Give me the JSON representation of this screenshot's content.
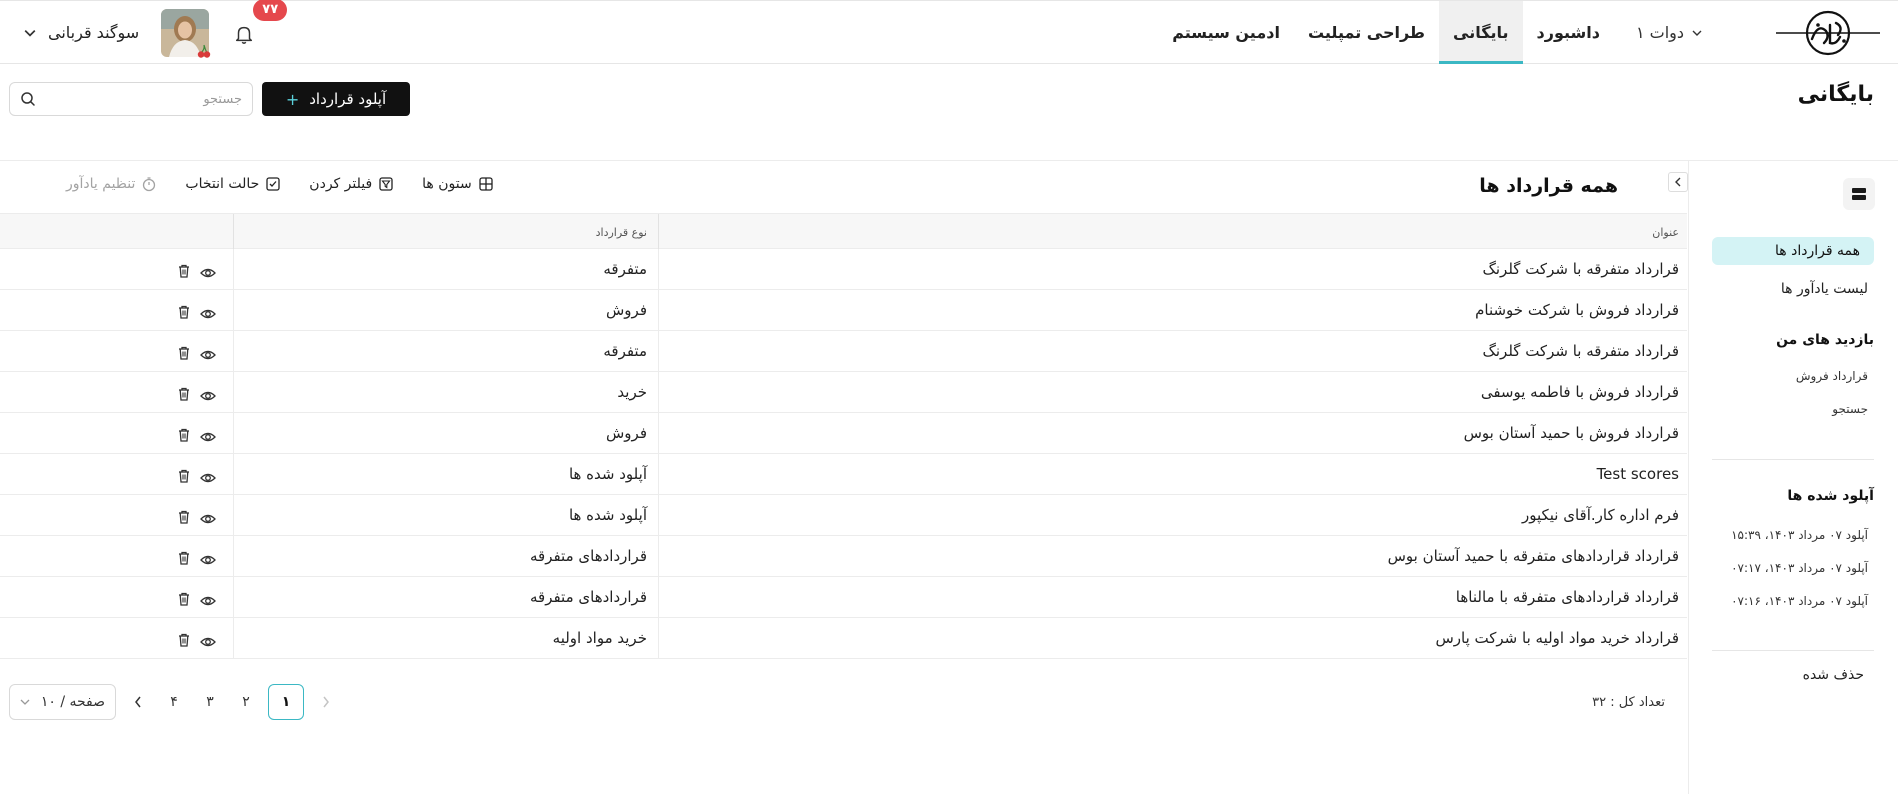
{
  "navbar": {
    "items": [
      {
        "label": "دوات ۱",
        "caret": true
      },
      {
        "label": "داشبورد"
      },
      {
        "label": "بایگانی",
        "active": true
      },
      {
        "label": "طراحی تمپلیت"
      },
      {
        "label": "ادمین سیستم"
      }
    ],
    "user_name": "سوگند قربانی",
    "notification_count": "۷۷"
  },
  "header": {
    "title": "بایگانی",
    "upload_label": "آپلود قرارداد",
    "search_placeholder": "جستجو"
  },
  "sidebar": {
    "active_item": "همه قرارداد ها",
    "reminders": "لیست یادآور ها",
    "visits_heading": "بازدید های من",
    "visits": [
      "قرارداد فروش",
      "جستجو"
    ],
    "uploads_heading": "آپلود شده ها",
    "uploads": [
      "آپلود ۰۷ مرداد ۱۴۰۳، ۱۵:۳۹",
      "آپلود ۰۷ مرداد ۱۴۰۳، ۰۷:۱۷",
      "آپلود ۰۷ مرداد ۱۴۰۳، ۰۷:۱۶"
    ],
    "deleted": "حذف شده"
  },
  "panel": {
    "title": "همه قرارداد ها",
    "tools": {
      "columns": "ستون ها",
      "filter": "فیلتر کردن",
      "select_mode": "حالت انتخاب",
      "set_reminder": "تنظیم یادآور"
    }
  },
  "table": {
    "headers": {
      "title": "عنوان",
      "type": "نوع قرارداد"
    },
    "rows": [
      {
        "title": "قرارداد متفرقه با شرکت گلرنگ",
        "type": "متفرقه"
      },
      {
        "title": "قرارداد فروش با شرکت خوشنام",
        "type": "فروش"
      },
      {
        "title": "قرارداد متفرقه با شرکت گلرنگ",
        "type": "متفرقه"
      },
      {
        "title": "قرارداد فروش با فاطمه یوسفی",
        "type": "خرید"
      },
      {
        "title": "قرارداد فروش با حمید آستان بوس",
        "type": "فروش"
      },
      {
        "title": "Test scores",
        "type": "آپلود شده ها"
      },
      {
        "title": "فرم اداره کار.آقای نیکپور",
        "type": "آپلود شده ها"
      },
      {
        "title": "قرارداد قراردادهای متفرقه با حمید آستان بوس",
        "type": "قراردادهای متفرقه"
      },
      {
        "title": "قرارداد قراردادهای متفرقه با مالناها",
        "type": "قراردادهای متفرقه"
      },
      {
        "title": "قرارداد خرید مواد اولیه با شرکت پارس",
        "type": "خرید مواد اولیه"
      }
    ]
  },
  "footer": {
    "total": "تعداد کل : ۳۲",
    "pages": [
      "۱",
      "۲",
      "۳",
      "۴"
    ],
    "current_page": "۱",
    "page_size": "۱۰ / صفحه"
  },
  "colors": {
    "accent": "#3bb8c4",
    "accent_light": "#d4f3f5",
    "primary_button": "#111111",
    "badge": "#e5484d"
  }
}
